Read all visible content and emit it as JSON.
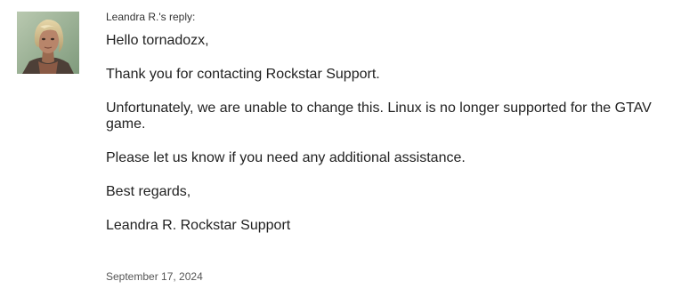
{
  "reply": {
    "author_heading": "Leandra R.'s reply:",
    "greeting": "Hello tornadozx,",
    "paragraph_1": "Thank you for contacting Rockstar Support.",
    "paragraph_2": "Unfortunately, we are unable to change this. Linux is no longer supported for the GTAV game.",
    "paragraph_3": "Please let us know if you need any additional assistance.",
    "closing": "Best regards,",
    "signature": "Leandra R. Rockstar Support",
    "date": "September 17, 2024"
  },
  "avatar": {
    "icon": "agent-avatar-icon",
    "colors": {
      "background": "#9fb59a",
      "hair": "#d9c79a",
      "skin": "#b07d5f",
      "jacket": "#5a4a40"
    }
  }
}
